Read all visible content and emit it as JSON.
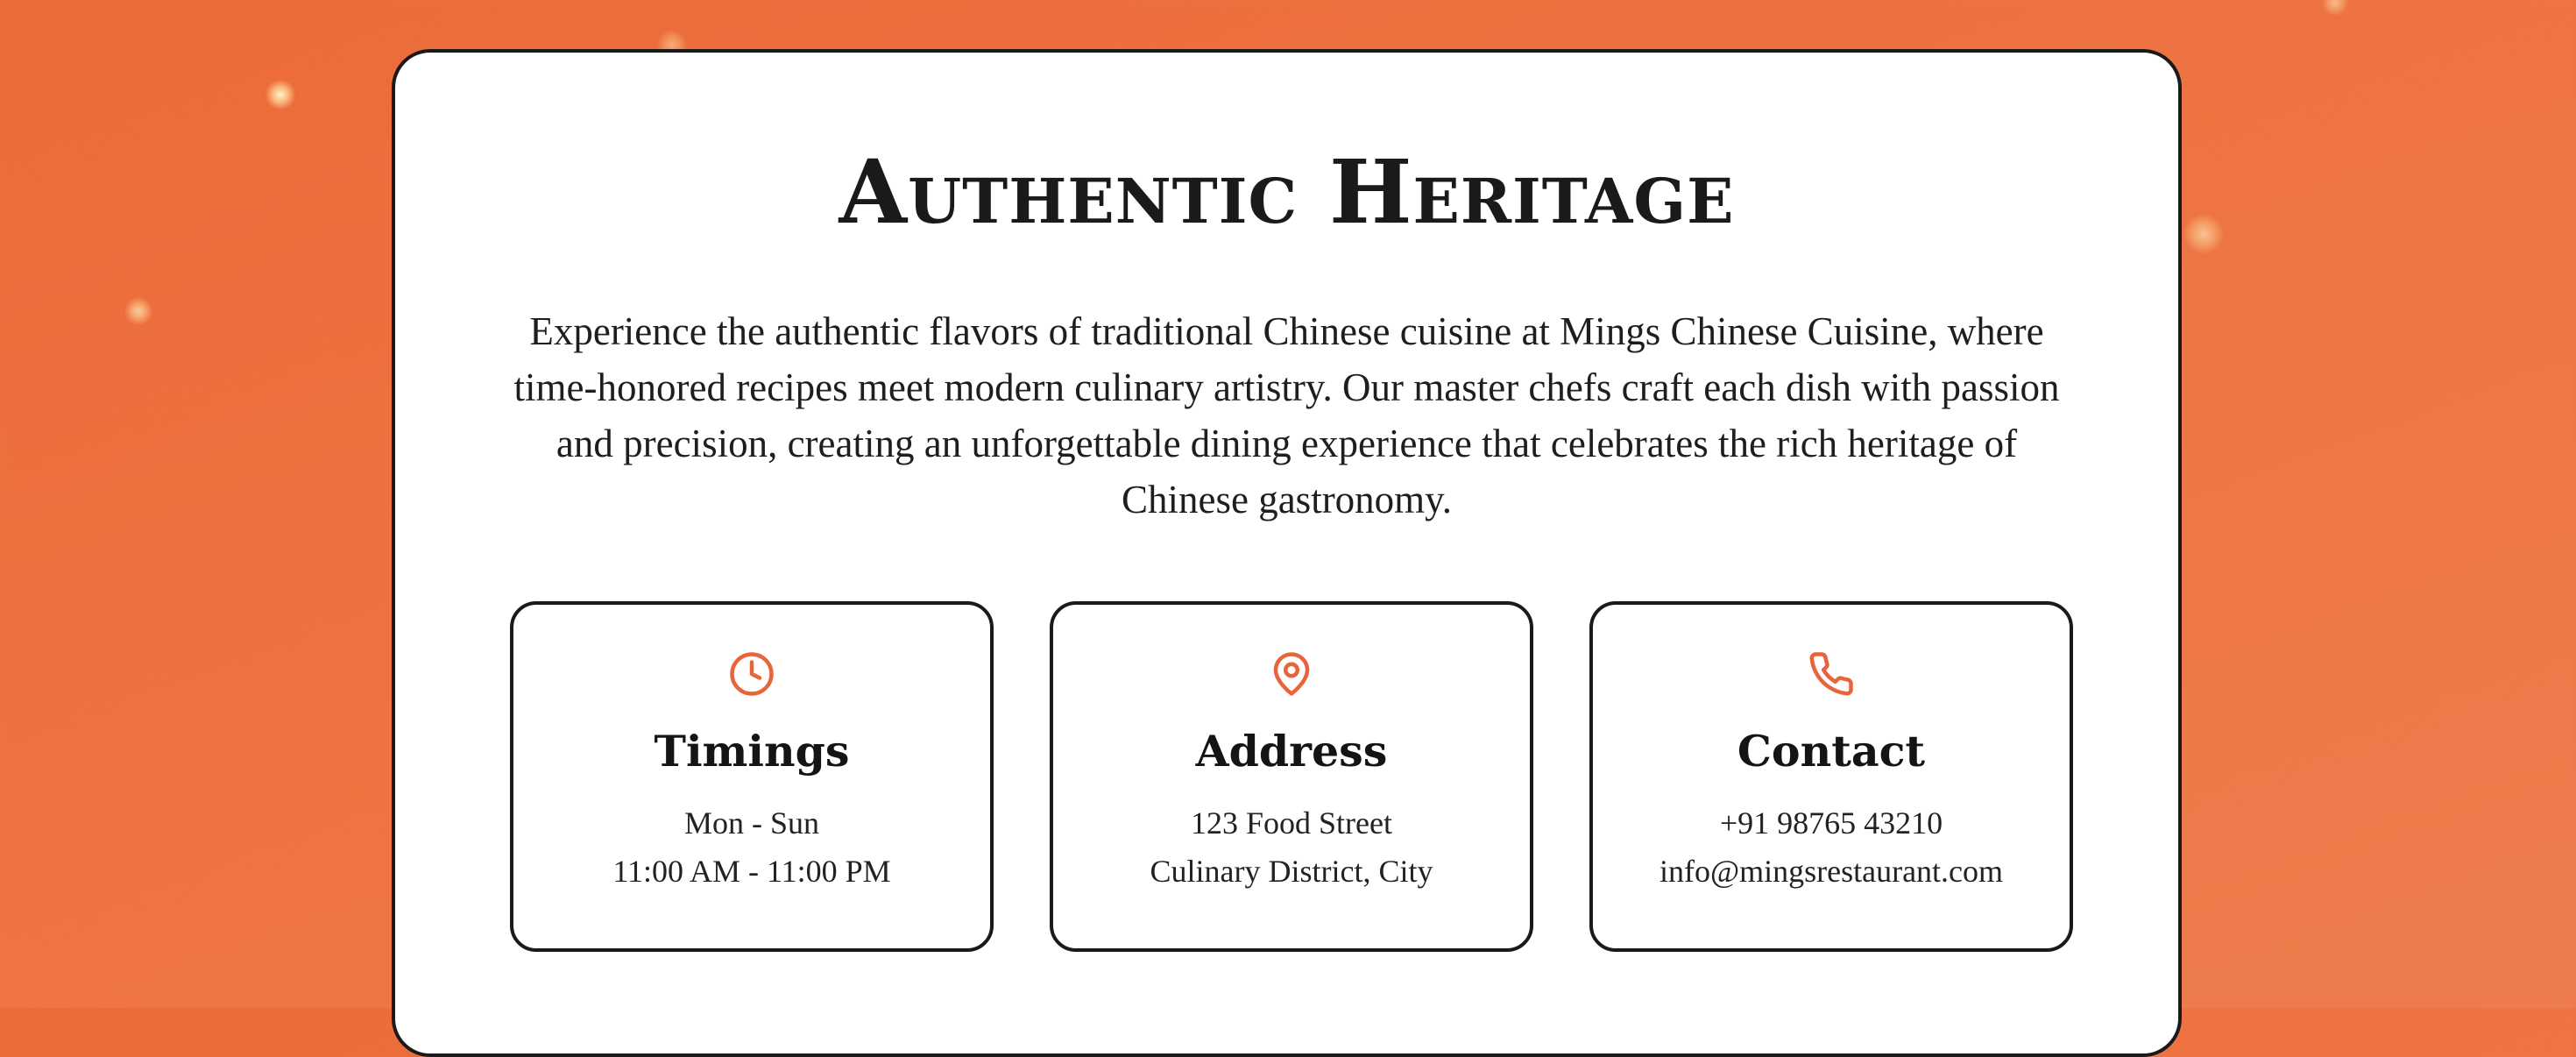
{
  "hero": {
    "title": "Authentic Heritage",
    "description": "Experience the authentic flavors of traditional Chinese cuisine at Mings Chinese Cuisine, where time-honored recipes meet modern culinary artistry. Our master chefs craft each dish with passion and precision, creating an unforgettable dining experience that celebrates the rich heritage of Chinese gastronomy."
  },
  "info_cards": [
    {
      "icon": "clock-icon",
      "heading": "Timings",
      "line1": "Mon - Sun",
      "line2": "11:00 AM - 11:00 PM"
    },
    {
      "icon": "map-pin-icon",
      "heading": "Address",
      "line1": "123 Food Street",
      "line2": "Culinary District, City"
    },
    {
      "icon": "phone-icon",
      "heading": "Contact",
      "line1": "+91 98765 43210",
      "line2": "info@mingsrestaurant.com"
    }
  ],
  "colors": {
    "background": "#ee7443",
    "accent": "#e8643a",
    "card_border": "#1a1a1a",
    "text": "#1a1a1a"
  }
}
